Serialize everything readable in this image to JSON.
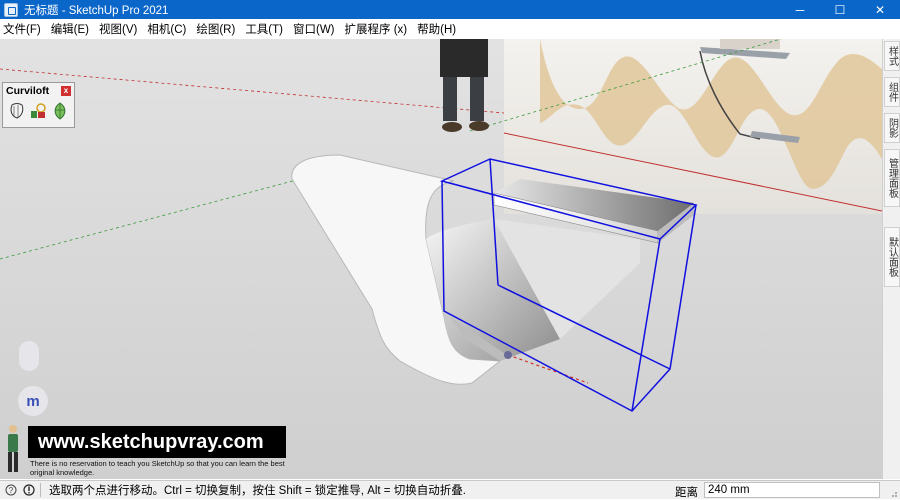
{
  "window": {
    "title": "无标题 - SketchUp Pro 2021",
    "minimize": "─",
    "maximize": "☐",
    "close": "✕"
  },
  "menu": [
    "文件(F)",
    "编辑(E)",
    "视图(V)",
    "相机(C)",
    "绘图(R)",
    "工具(T)",
    "窗口(W)",
    "扩展程序 (x)",
    "帮助(H)"
  ],
  "tray_tabs": [
    "样式",
    "组件",
    "阴影",
    "管理面板",
    "默认面板"
  ],
  "curviloft": {
    "title": "Curviloft",
    "close": "x",
    "tools": [
      "loft-by-spline-icon",
      "skin-contours-icon",
      "loft-along-path-icon"
    ]
  },
  "floating": {
    "m_label": "m"
  },
  "watermark": {
    "site": "www.sketchupvray.com",
    "tagline": "There is no reservation to teach you SketchUp so that you can learn the best original knowledge."
  },
  "status": {
    "message": "选取两个点进行移动。Ctrl = 切换复制，按住 Shift = 锁定推导, Alt = 切换自动折叠.",
    "measure_label": "距离",
    "measure_value": "240 mm"
  },
  "colors": {
    "titlebar": "#0a66c9",
    "viewport_bg": "#d4d4d4",
    "selection_box": "#1010e0",
    "red_axis": "#c03030",
    "green_axis": "#3a9a3a"
  }
}
